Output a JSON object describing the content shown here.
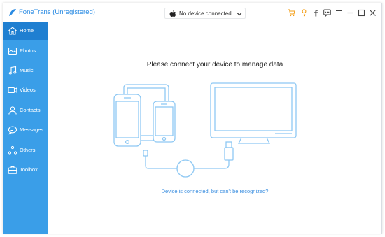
{
  "app": {
    "title": "FoneTrans (Unregistered)",
    "logo_icon": "fonetrans-logo-icon"
  },
  "device_selector": {
    "label": "No device connected",
    "icon": "apple-icon"
  },
  "toolbar": {
    "icons": [
      "cart-icon",
      "key-icon",
      "facebook-icon",
      "chat-icon",
      "menu-icon",
      "minimize-icon",
      "maximize-icon",
      "close-icon"
    ]
  },
  "sidebar": {
    "items": [
      {
        "label": "Home",
        "icon": "home-icon",
        "active": true
      },
      {
        "label": "Photos",
        "icon": "photos-icon",
        "active": false
      },
      {
        "label": "Music",
        "icon": "music-icon",
        "active": false
      },
      {
        "label": "Videos",
        "icon": "videos-icon",
        "active": false
      },
      {
        "label": "Contacts",
        "icon": "contacts-icon",
        "active": false
      },
      {
        "label": "Messages",
        "icon": "messages-icon",
        "active": false
      },
      {
        "label": "Others",
        "icon": "others-icon",
        "active": false
      },
      {
        "label": "Toolbox",
        "icon": "toolbox-icon",
        "active": false
      }
    ]
  },
  "main": {
    "headline": "Please connect your device to manage data",
    "help_link": "Device is connected, but can't be recognized?"
  },
  "colors": {
    "sidebar": "#3a9ee8",
    "sidebar_active": "#1f7fd1",
    "accent": "#2a8be3",
    "toolbar_orange": "#f39c12",
    "illustration": "#8ec8f3"
  }
}
